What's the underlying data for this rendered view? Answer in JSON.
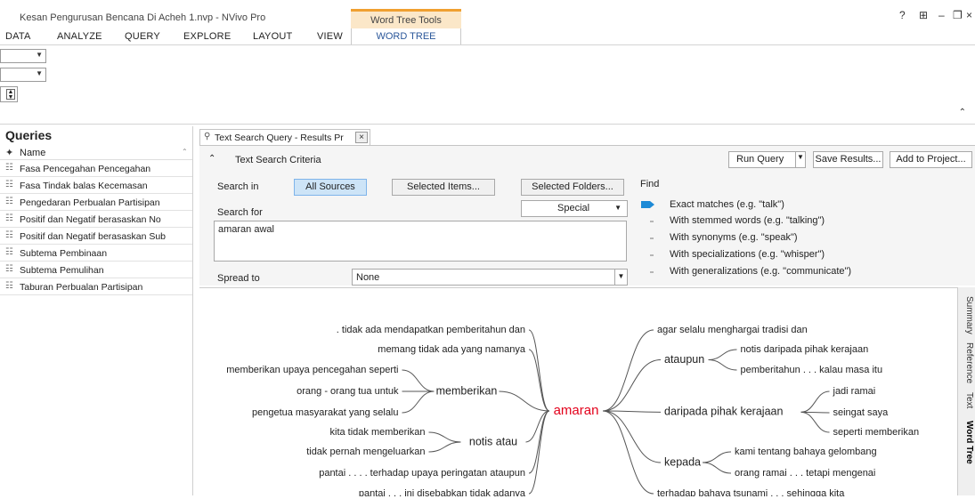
{
  "window": {
    "title": "Kesan Pengurusan Bencana Di Acheh 1.nvp - NVivo Pro",
    "context_tab_group": "Word Tree Tools",
    "controls": [
      "?",
      "⊞",
      "–",
      "❐",
      "×"
    ]
  },
  "menu": {
    "items": [
      "DATA",
      "ANALYZE",
      "QUERY",
      "EXPLORE",
      "LAYOUT",
      "VIEW"
    ],
    "active_tab": "WORD TREE"
  },
  "queries_panel": {
    "title": "Queries",
    "column": "Name",
    "items": [
      "Fasa Pencegahan Pencegahan",
      "Fasa Tindak balas Kecemasan",
      "Pengedaran Perbualan Partisipan",
      "Positif dan Negatif berasaskan No",
      "Positif dan Negatif berasaskan Sub",
      "Subtema Pembinaan",
      "Subtema Pemulihan",
      "Taburan Perbualan Partisipan"
    ]
  },
  "document_tab": {
    "label": "Text Search Query - Results Pr"
  },
  "criteria": {
    "title": "Text Search Criteria",
    "run_query": "Run Query",
    "save_results": "Save Results...",
    "add_to_project": "Add to Project...",
    "search_in_label": "Search in",
    "all_sources": "All Sources",
    "selected_items": "Selected Items...",
    "selected_folders": "Selected Folders...",
    "search_for_label": "Search for",
    "special": "Special",
    "search_text": "amaran awal",
    "spread_to_label": "Spread to",
    "spread_to_value": "None",
    "find_label": "Find",
    "find_options": [
      "Exact matches (e.g. \"talk\")",
      "With stemmed words (e.g. \"talking\")",
      "With synonyms (e.g. \"speak\")",
      "With specializations (e.g. \"whisper\")",
      "With generalizations (e.g. \"communicate\")"
    ],
    "find_level": 0
  },
  "word_tree": {
    "root": "amaran",
    "left": {
      "direct": [
        ". tidak ada mendapatkan pemberitahun dan",
        "memang tidak ada yang namanya",
        "pantai . . . . terhadap upaya peringatan ataupun",
        "pantai . . . ini disebabkan tidak adanya"
      ],
      "groups": [
        {
          "word": "memberikan",
          "phrases": [
            "memberikan upaya pencegahan seperti",
            "orang - orang tua untuk",
            "pengetua masyarakat yang selalu"
          ]
        },
        {
          "word": "notis atau",
          "phrases": [
            "kita tidak memberikan",
            "tidak pernah mengeluarkan"
          ]
        }
      ]
    },
    "right": {
      "direct": [
        "agar selalu menghargai tradisi dan",
        "terhadap bahaya tsunami . . . sehingga kita"
      ],
      "groups": [
        {
          "word": "ataupun",
          "phrases": [
            "notis daripada pihak kerajaan",
            "pemberitahun . . . kalau masa itu"
          ]
        },
        {
          "word": "daripada pihak kerajaan",
          "phrases": [
            "jadi ramai",
            "seingat saya",
            "seperti memberikan"
          ]
        },
        {
          "word": "kepada",
          "phrases": [
            "kami tentang bahaya gelombang",
            "orang ramai . . . tetapi mengenai"
          ]
        }
      ]
    }
  },
  "side_tabs": [
    "Summary",
    "Reference",
    "Text",
    "Word Tree"
  ],
  "side_tab_selected": "Word Tree",
  "colors": {
    "root": "#e3001b",
    "accent": "#2b579a",
    "find_marker": "#1e8ad6",
    "context_tab": "#fbe7c8"
  }
}
